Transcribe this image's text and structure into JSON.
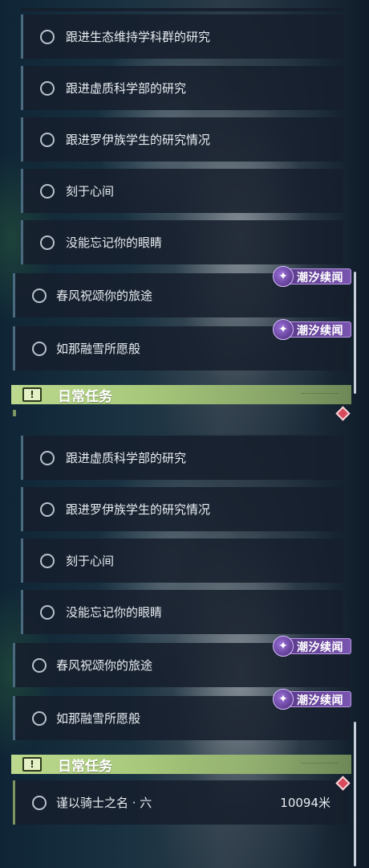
{
  "badge_text": "潮汐续闻",
  "daily_title": "日常任务",
  "panel1": {
    "sub_items": [
      "跟进生态维持学科群的研究",
      "跟进虚质科学部的研究",
      "跟进罗伊族学生的研究情况",
      "刻于心间",
      "没能忘记你的眼睛"
    ],
    "main_items": [
      "春风祝颂你的旅途",
      "如那融雪所愿般"
    ]
  },
  "panel2": {
    "sub_items": [
      "跟进虚质科学部的研究",
      "跟进罗伊族学生的研究情况",
      "刻于心间",
      "没能忘记你的眼睛"
    ],
    "main_items": [
      "春风祝颂你的旅途",
      "如那融雪所愿般"
    ],
    "daily_item": {
      "label": "谨以骑士之名 · 六",
      "distance": "10094米"
    }
  }
}
